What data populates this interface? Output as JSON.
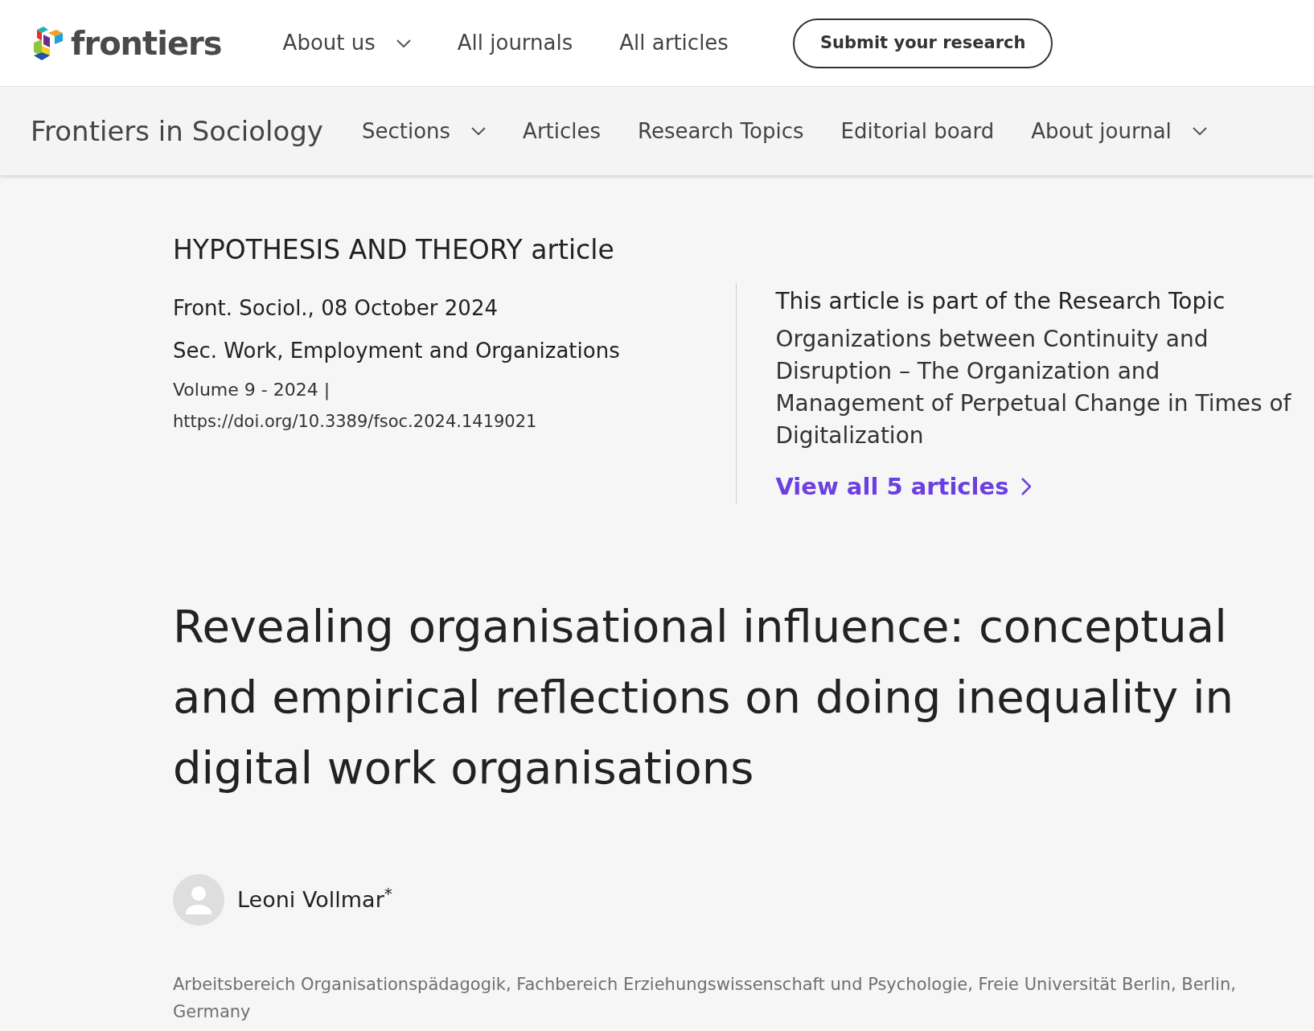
{
  "header": {
    "logo_text": "frontiers",
    "nav": [
      {
        "label": "About us",
        "has_dropdown": true
      },
      {
        "label": "All journals",
        "has_dropdown": false
      },
      {
        "label": "All articles",
        "has_dropdown": false
      }
    ],
    "cta": "Submit your research"
  },
  "journal_bar": {
    "title": "Frontiers in Sociology",
    "nav": [
      {
        "label": "Sections",
        "has_dropdown": true
      },
      {
        "label": "Articles",
        "has_dropdown": false
      },
      {
        "label": "Research Topics",
        "has_dropdown": false
      },
      {
        "label": "Editorial board",
        "has_dropdown": false
      },
      {
        "label": "About journal",
        "has_dropdown": true
      }
    ]
  },
  "article": {
    "type": "HYPOTHESIS AND THEORY article",
    "citation": "Front. Sociol., 08 October 2024",
    "section": "Sec. Work, Employment and Organizations",
    "volume": "Volume 9 - 2024 |",
    "doi": "https://doi.org/10.3389/fsoc.2024.1419021",
    "research_topic": {
      "heading": "This article is part of the Research Topic",
      "title": "Organizations between Continuity and Disruption – The Organization and Management of Perpetual Change in Times of Digitalization",
      "link": "View all 5 articles"
    },
    "title": "Revealing organisational influence: conceptual and empirical reflections on doing inequality in digital work organisations",
    "authors": [
      {
        "name": "Leoni Vollmar$^{*}$"
      }
    ],
    "affiliation": "Arbeitsbereich Organisationspädagogik, Fachbereich Erziehungswissenschaft und Psychologie, Freie Universität Berlin, Berlin, Germany"
  }
}
